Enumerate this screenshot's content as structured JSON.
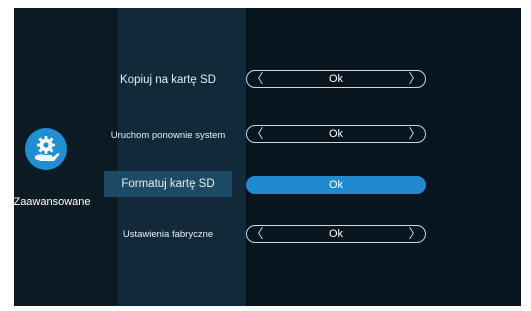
{
  "category": {
    "label": "Zaawansowane",
    "icon": "gear-hand-icon",
    "accent": "#1e8fd3"
  },
  "menu": [
    {
      "label": "Kopiuj na kartę SD",
      "value": "Ok"
    },
    {
      "label": "Uruchom ponownie system",
      "value": "Ok"
    },
    {
      "label": "Formatuj kartę SD",
      "value": "Ok"
    },
    {
      "label": "Ustawienia fabryczne",
      "value": "Ok"
    }
  ],
  "selected_index": 2,
  "arrows": {
    "left": "〈",
    "right": "〉"
  }
}
